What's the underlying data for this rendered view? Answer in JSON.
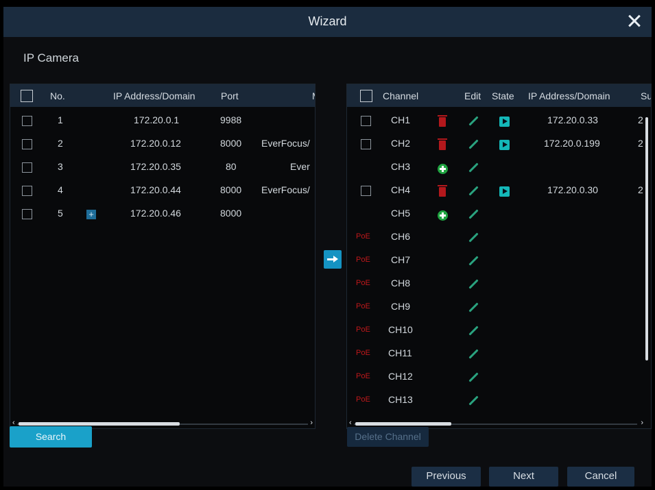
{
  "window": {
    "title": "Wizard"
  },
  "section_title": "IP Camera",
  "left_table": {
    "headers": {
      "no": "No.",
      "ip": "IP Address/Domain",
      "port": "Port",
      "manufacturer": "M"
    },
    "rows": [
      {
        "no": "1",
        "ip": "172.20.0.1",
        "port": "9988",
        "manufacturer": ""
      },
      {
        "no": "2",
        "ip": "172.20.0.12",
        "port": "8000",
        "manufacturer": "EverFocus/"
      },
      {
        "no": "3",
        "ip": "172.20.0.35",
        "port": "80",
        "manufacturer": "Ever"
      },
      {
        "no": "4",
        "ip": "172.20.0.44",
        "port": "8000",
        "manufacturer": "EverFocus/"
      },
      {
        "no": "5",
        "ip": "172.20.0.46",
        "port": "8000",
        "manufacturer": ""
      }
    ]
  },
  "right_table": {
    "headers": {
      "channel": "Channel",
      "edit": "Edit",
      "state": "State",
      "ip": "IP Address/Domain",
      "subnet": "Su"
    },
    "rows": [
      {
        "channel": "CH1",
        "ip": "172.20.0.33",
        "subnet": "2"
      },
      {
        "channel": "CH2",
        "ip": "172.20.0.199",
        "subnet": "2"
      },
      {
        "channel": "CH3",
        "ip": "",
        "subnet": ""
      },
      {
        "channel": "CH4",
        "ip": "172.20.0.30",
        "subnet": "2"
      },
      {
        "channel": "CH5",
        "ip": "",
        "subnet": ""
      },
      {
        "channel": "CH6",
        "poe": "PoE"
      },
      {
        "channel": "CH7",
        "poe": "PoE"
      },
      {
        "channel": "CH8",
        "poe": "PoE"
      },
      {
        "channel": "CH9",
        "poe": "PoE"
      },
      {
        "channel": "CH10",
        "poe": "PoE"
      },
      {
        "channel": "CH11",
        "poe": "PoE"
      },
      {
        "channel": "CH12",
        "poe": "PoE"
      },
      {
        "channel": "CH13",
        "poe": "PoE"
      }
    ]
  },
  "buttons": {
    "search": "Search",
    "delete_channel": "Delete Channel",
    "previous": "Previous",
    "next": "Next",
    "cancel": "Cancel"
  },
  "colors": {
    "titlebar": "#1b2c3f",
    "accent": "#1aa1c9",
    "delete_red": "#b3181c",
    "add_green": "#1fa340",
    "edit_green": "#2aa37f",
    "state_teal": "#14b7b8",
    "poe_red": "#c0181b"
  }
}
